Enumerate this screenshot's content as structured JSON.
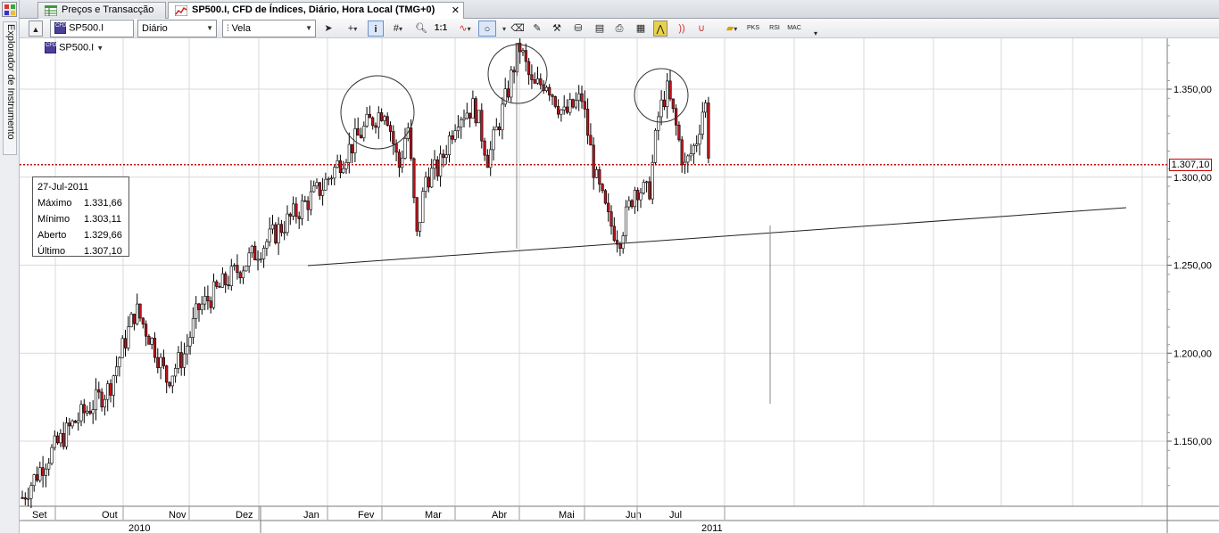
{
  "sidebar": {
    "label": "Explorador de Instrumento"
  },
  "tabs": [
    {
      "label": "Preços e Transacção",
      "active": false
    },
    {
      "label": "SP500.I, CFD de Índices, Diário, Hora Local (TMG+0)",
      "active": true,
      "close": "✕"
    }
  ],
  "toolbar": {
    "instrument": "SP500.I",
    "period": "Diário",
    "chart_type": "Vela",
    "zoom_label": "1:1",
    "indicators": [
      "PKS",
      "RSI",
      "MAC"
    ],
    "cfd_badge": "CFD"
  },
  "chart": {
    "instrument_label": "SP500.I",
    "current_price": "1.307,10",
    "price_axis": [
      "1.350,00",
      "1.300,00",
      "1.250,00",
      "1.200,00",
      "1.150,00"
    ],
    "months": [
      "Set",
      "Out",
      "Nov",
      "Dez",
      "Jan",
      "Fev",
      "Mar",
      "Abr",
      "Mai",
      "Jun",
      "Jul"
    ],
    "years": [
      "2010",
      "2011"
    ],
    "info": {
      "date": "27-Jul-2011",
      "rows": [
        {
          "k": "Máximo",
          "v": "1.331,66"
        },
        {
          "k": "Mínimo",
          "v": "1.303,11"
        },
        {
          "k": "Aberto",
          "v": "1.329,66"
        },
        {
          "k": "Último",
          "v": "1.307,10"
        }
      ]
    },
    "colors": {
      "bull": "#ffffff",
      "bear": "#c0141c",
      "wick": "#000000",
      "price_line": "#c00000",
      "grid": "#d9d9d9"
    }
  }
}
